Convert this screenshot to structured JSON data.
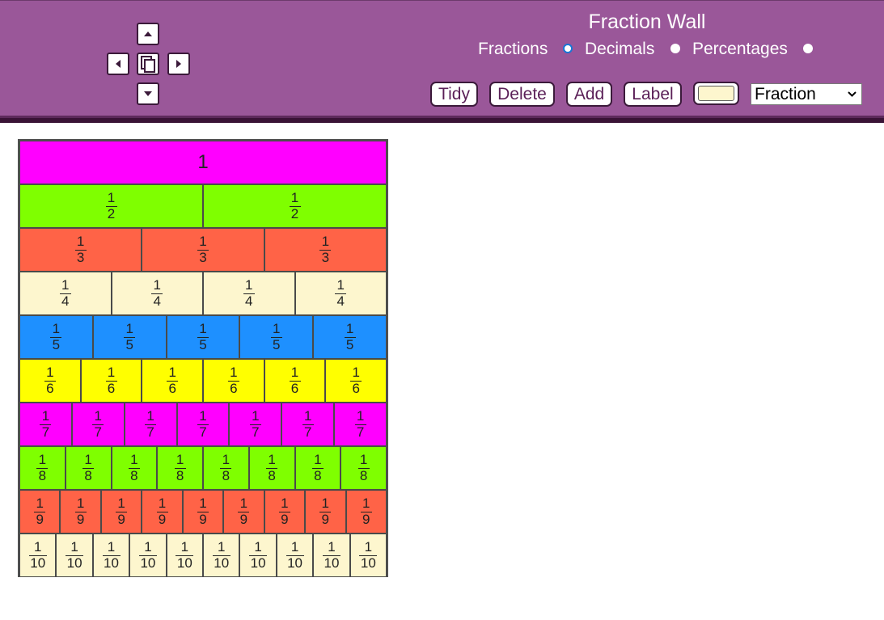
{
  "header": {
    "title": "Fraction Wall",
    "display_modes": [
      {
        "label": "Fractions",
        "checked": true
      },
      {
        "label": "Decimals",
        "checked": false
      },
      {
        "label": "Percentages",
        "checked": false
      }
    ]
  },
  "toolbar": {
    "tidy_label": "Tidy",
    "delete_label": "Delete",
    "add_label": "Add",
    "label_label": "Label",
    "selected_color": "#fdf6ce",
    "label_type": "Fraction"
  },
  "nav": {
    "up": "up-arrow-icon",
    "down": "down-arrow-icon",
    "left": "left-arrow-icon",
    "right": "right-arrow-icon",
    "copy": "copy-icon"
  },
  "colors": {
    "header_bg": "#9a5799",
    "row_1": "#ff00ff",
    "row_2": "#7fff00",
    "row_3": "#ff6347",
    "row_4": "#fdf6ce",
    "row_5": "#1e90ff",
    "row_6": "#ffff00",
    "row_7": "#ff00ff",
    "row_8": "#7fff00",
    "row_9": "#ff6347",
    "row_10": "#fdf6ce"
  },
  "wall": {
    "rows": [
      {
        "denominator": 1,
        "label": "1",
        "color": "#ff00ff"
      },
      {
        "denominator": 2,
        "numerator": "1",
        "den_label": "2",
        "color": "#7fff00"
      },
      {
        "denominator": 3,
        "numerator": "1",
        "den_label": "3",
        "color": "#ff6347"
      },
      {
        "denominator": 4,
        "numerator": "1",
        "den_label": "4",
        "color": "#fdf6ce"
      },
      {
        "denominator": 5,
        "numerator": "1",
        "den_label": "5",
        "color": "#1e90ff"
      },
      {
        "denominator": 6,
        "numerator": "1",
        "den_label": "6",
        "color": "#ffff00"
      },
      {
        "denominator": 7,
        "numerator": "1",
        "den_label": "7",
        "color": "#ff00ff"
      },
      {
        "denominator": 8,
        "numerator": "1",
        "den_label": "8",
        "color": "#7fff00"
      },
      {
        "denominator": 9,
        "numerator": "1",
        "den_label": "9",
        "color": "#ff6347"
      },
      {
        "denominator": 10,
        "numerator": "1",
        "den_label": "10",
        "color": "#fdf6ce"
      }
    ]
  }
}
